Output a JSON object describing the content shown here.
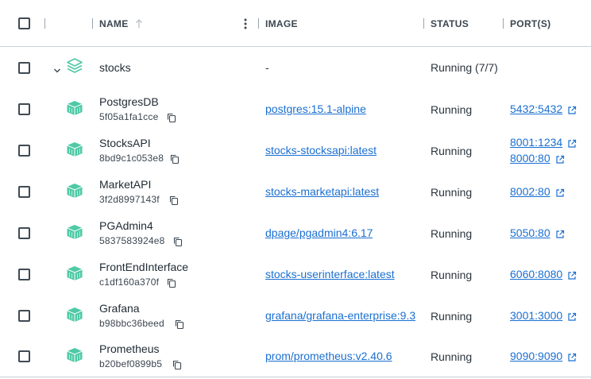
{
  "header": {
    "name_label": "NAME",
    "image_label": "IMAGE",
    "status_label": "STATUS",
    "ports_label": "PORT(S)"
  },
  "group": {
    "name": "stocks",
    "image": "-",
    "status": "Running (7/7)"
  },
  "containers": [
    {
      "name": "PostgresDB",
      "id": "5f05a1fa1cce",
      "image": "postgres:15.1-alpine",
      "status": "Running",
      "ports": [
        "5432:5432"
      ]
    },
    {
      "name": "StocksAPI",
      "id": "8bd9c1c053e8",
      "image": "stocks-stocksapi:latest",
      "status": "Running",
      "ports": [
        "8001:1234",
        "8000:80"
      ]
    },
    {
      "name": "MarketAPI",
      "id": "3f2d8997143f",
      "image": "stocks-marketapi:latest",
      "status": "Running",
      "ports": [
        "8002:80"
      ]
    },
    {
      "name": "PGAdmin4",
      "id": "5837583924e8",
      "image": "dpage/pgadmin4:6.17",
      "status": "Running",
      "ports": [
        "5050:80"
      ]
    },
    {
      "name": "FrontEndInterface",
      "id": "c1df160a370f",
      "image": "stocks-userinterface:latest",
      "status": "Running",
      "ports": [
        "6060:8080"
      ]
    },
    {
      "name": "Grafana",
      "id": "b98bbc36beed",
      "image": "grafana/grafana-enterprise:9.3",
      "status": "Running",
      "ports": [
        "3001:3000"
      ]
    },
    {
      "name": "Prometheus",
      "id": "b20bef0899b5",
      "image": "prom/prometheus:v2.40.6",
      "status": "Running",
      "ports": [
        "9090:9090"
      ]
    }
  ],
  "colors": {
    "accent_link": "#1a6fd1",
    "container_icon": "#4fc9a6"
  }
}
